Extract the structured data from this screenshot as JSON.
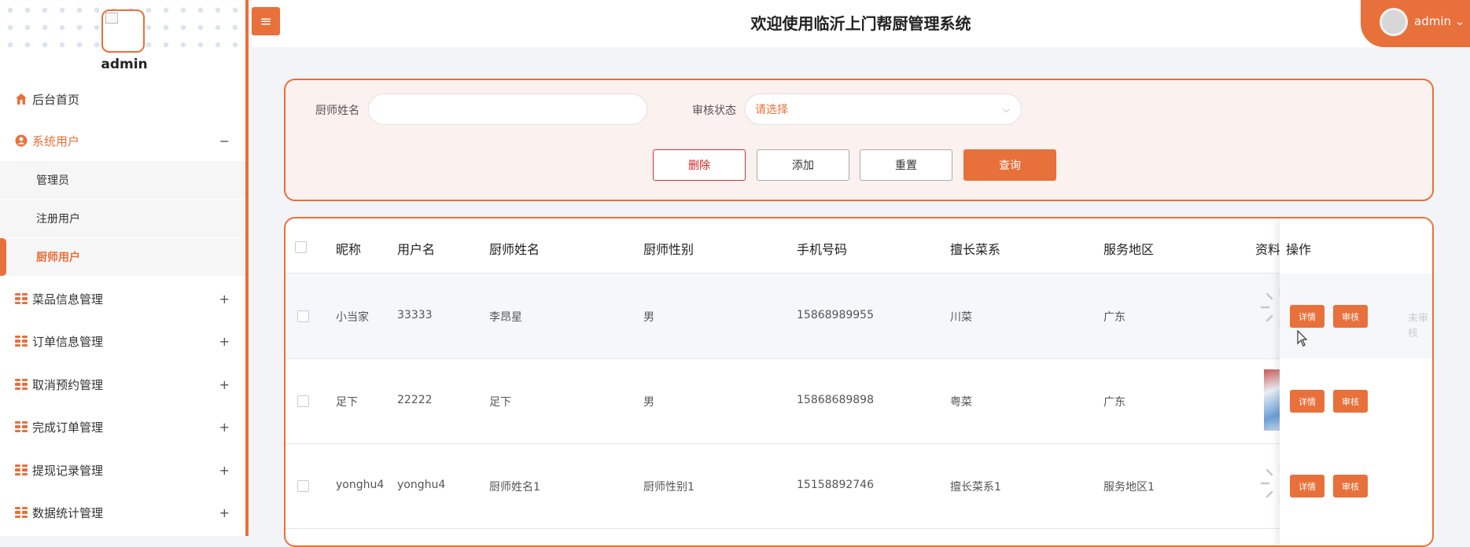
{
  "sidebar": {
    "username": "admin",
    "items": [
      {
        "label": "后台首页",
        "icon": "home-icon"
      },
      {
        "label": "系统用户",
        "icon": "user-circle-icon",
        "toggle": "−",
        "expanded": true,
        "children": [
          {
            "label": "管理员"
          },
          {
            "label": "注册用户"
          },
          {
            "label": "厨师用户",
            "active": true
          }
        ]
      },
      {
        "label": "菜品信息管理",
        "icon": "grid-icon",
        "toggle": "+"
      },
      {
        "label": "订单信息管理",
        "icon": "grid-icon",
        "toggle": "+"
      },
      {
        "label": "取消预约管理",
        "icon": "grid-icon",
        "toggle": "+"
      },
      {
        "label": "完成订单管理",
        "icon": "grid-icon",
        "toggle": "+"
      },
      {
        "label": "提现记录管理",
        "icon": "grid-icon",
        "toggle": "+"
      },
      {
        "label": "数据统计管理",
        "icon": "grid-icon",
        "toggle": "+"
      }
    ]
  },
  "header": {
    "menu_icon": "≡",
    "title": "欢迎使用临沂上门帮厨管理系统",
    "user": "admin",
    "user_chevron": "⌄"
  },
  "search": {
    "name_label": "厨师姓名",
    "name_value": "",
    "status_label": "审核状态",
    "status_placeholder": "请选择",
    "chevron": "⌵",
    "buttons": {
      "delete": "删除",
      "add": "添加",
      "reset": "重置",
      "query": "查询"
    }
  },
  "table": {
    "columns": [
      "昵称",
      "用户名",
      "厨师姓名",
      "厨师性别",
      "手机号码",
      "擅长菜系",
      "服务地区",
      "资料",
      "操作"
    ],
    "rows": [
      {
        "nickname": "小当家",
        "username": "33333",
        "chef_name": "李昂星",
        "gender": "男",
        "phone": "15868989955",
        "cuisine": "川菜",
        "region": "广东",
        "detail": "详情",
        "review": "审核",
        "status": "未审核"
      },
      {
        "nickname": "足下",
        "username": "22222",
        "chef_name": "足下",
        "gender": "男",
        "phone": "15868689898",
        "cuisine": "粤菜",
        "region": "广东",
        "detail": "详情",
        "review": "审核"
      },
      {
        "nickname": "yonghu4",
        "username": "yonghu4",
        "chef_name": "厨师姓名1",
        "gender": "厨师性别1",
        "phone": "15158892746",
        "cuisine": "擅长菜系1",
        "region": "服务地区1",
        "detail": "详情",
        "review": "审核"
      }
    ]
  },
  "colors": {
    "accent": "#e8703a",
    "danger": "#dd2222"
  }
}
